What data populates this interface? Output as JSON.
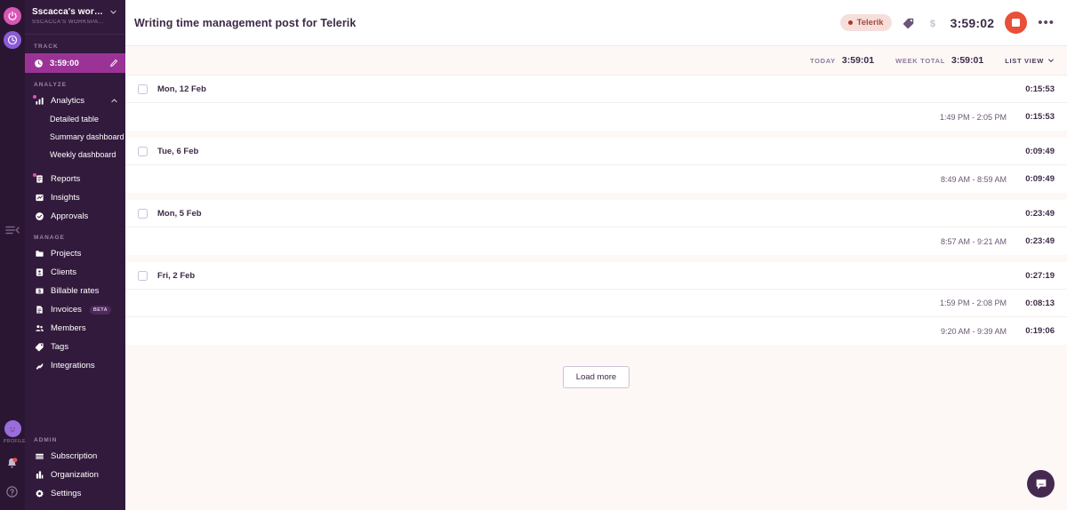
{
  "rail": {
    "icons": [
      {
        "name": "power-app-icon",
        "color": "#d857b4"
      },
      {
        "name": "clock-app-icon",
        "color": "#8a5cd6"
      }
    ],
    "collapse_label": "Collapse sidebar",
    "profile_label": "PROFILE",
    "bell_label": "Notifications",
    "help_label": "Help"
  },
  "sidebar": {
    "workspace_title": "Sscacca's work…",
    "workspace_subtitle": "SSCACCA'S WORKSPA…",
    "sections": {
      "track": {
        "label": "TRACK",
        "timer": "3:59:00"
      },
      "analyze": {
        "label": "ANALYZE",
        "analytics_label": "Analytics",
        "sub_items": [
          {
            "label": "Detailed table"
          },
          {
            "label": "Summary dashboard"
          },
          {
            "label": "Weekly dashboard"
          }
        ],
        "items": [
          {
            "label": "Reports",
            "icon": "reports-icon",
            "badge": true
          },
          {
            "label": "Insights",
            "icon": "insights-icon",
            "badge": false
          },
          {
            "label": "Approvals",
            "icon": "approvals-icon",
            "badge": false
          }
        ]
      },
      "manage": {
        "label": "MANAGE",
        "items": [
          {
            "label": "Projects",
            "icon": "folder-icon",
            "tag": ""
          },
          {
            "label": "Clients",
            "icon": "client-icon",
            "tag": ""
          },
          {
            "label": "Billable rates",
            "icon": "billable-icon",
            "tag": ""
          },
          {
            "label": "Invoices",
            "icon": "invoice-icon",
            "tag": "BETA"
          },
          {
            "label": "Members",
            "icon": "members-icon",
            "tag": ""
          },
          {
            "label": "Tags",
            "icon": "tag-icon",
            "tag": ""
          },
          {
            "label": "Integrations",
            "icon": "integrations-icon",
            "tag": ""
          }
        ]
      },
      "admin": {
        "label": "ADMIN",
        "items": [
          {
            "label": "Subscription",
            "icon": "card-icon"
          },
          {
            "label": "Organization",
            "icon": "organization-icon"
          },
          {
            "label": "Settings",
            "icon": "gear-icon"
          }
        ]
      }
    }
  },
  "topbar": {
    "entry_title": "Writing time management post for Telerik",
    "project_name": "Telerik",
    "project_dot_color": "#b4322a",
    "tag_icon": "tag-icon",
    "billable_icon": "dollar-icon",
    "timer": "3:59:02",
    "stop_label": "Stop timer",
    "more_label": "•••"
  },
  "summary": {
    "today_label": "TODAY",
    "today_value": "3:59:01",
    "week_label": "WEEK TOTAL",
    "week_value": "3:59:01",
    "view_label": "LIST VIEW"
  },
  "list": {
    "days": [
      {
        "date": "Mon, 12 Feb",
        "total": "0:15:53",
        "entries": [
          {
            "range": "1:49 PM - 2:05 PM",
            "duration": "0:15:53"
          }
        ]
      },
      {
        "date": "Tue, 6 Feb",
        "total": "0:09:49",
        "entries": [
          {
            "range": "8:49 AM - 8:59 AM",
            "duration": "0:09:49"
          }
        ]
      },
      {
        "date": "Mon, 5 Feb",
        "total": "0:23:49",
        "entries": [
          {
            "range": "8:57 AM - 9:21 AM",
            "duration": "0:23:49"
          }
        ]
      },
      {
        "date": "Fri, 2 Feb",
        "total": "0:27:19",
        "entries": [
          {
            "range": "1:59 PM - 2:08 PM",
            "duration": "0:08:13"
          },
          {
            "range": "9:20 AM - 9:39 AM",
            "duration": "0:19:06"
          }
        ]
      }
    ],
    "load_more_label": "Load more"
  },
  "chat": {
    "label": "Open chat",
    "icon": "chat-bubble-icon"
  }
}
